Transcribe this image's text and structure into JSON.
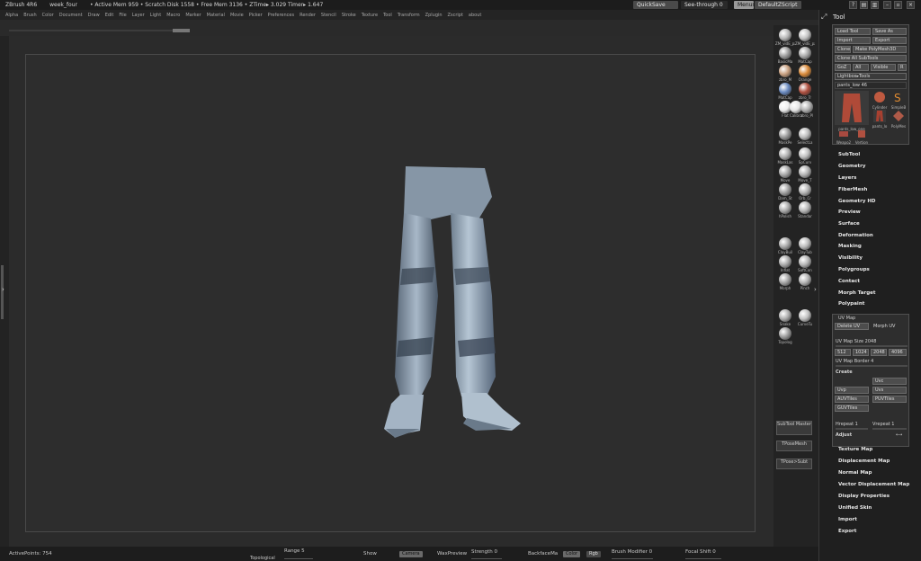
{
  "titlebar": {
    "app": "ZBrush 4R6",
    "doc": "week_four",
    "mem": "• Active Mem 959 • Scratch Disk 1558 • Free Mem 3136 • ZTime▸ 3.029 Timer▸ 1.647",
    "quicksave": "QuickSave",
    "seethrough": "See-through 0",
    "menus": "Menus",
    "script": "DefaultZScript"
  },
  "menubar": [
    "Alpha",
    "Brush",
    "Color",
    "Document",
    "Draw",
    "Edit",
    "File",
    "Layer",
    "Light",
    "Macro",
    "Marker",
    "Material",
    "Movie",
    "Picker",
    "Preferences",
    "Render",
    "Stencil",
    "Stroke",
    "Texture",
    "Tool",
    "Transform",
    "Zplugin",
    "Zscript",
    "about"
  ],
  "shelf": {
    "brushes": [
      {
        "label": "ZM_vidE_palt",
        "color": "#b8b8b8"
      },
      {
        "label": "ZM_vidE_palt",
        "color": "#c4c4c4"
      },
      {
        "label": "BasicMa",
        "color": "#9c9c9c"
      },
      {
        "label": "MatCap",
        "color": "#a9a9a9"
      },
      {
        "label": "zbro_M",
        "color": "#c8a080"
      },
      {
        "label": "Orange",
        "color": "#d98a3a"
      },
      {
        "label": "MatCap",
        "color": "#6a8ac0"
      },
      {
        "label": "zbro_Tr",
        "color": "#b05040"
      },
      {
        "label": "Flat",
        "color": "#eeeeee"
      },
      {
        "label": "Calibra",
        "color": "#e6e6e6"
      },
      {
        "label": "zbro_Pl",
        "color": "#b0b0b0"
      },
      {
        "label": "MaskPe",
        "color": "#9a9a9a"
      },
      {
        "label": "SelectLa",
        "color": "#bdbdbd"
      },
      {
        "label": "MaskLas",
        "color": "#b0b0b0"
      },
      {
        "label": "SpCurv",
        "color": "#c0c0c0"
      },
      {
        "label": "Move",
        "color": "#a6a6a6"
      },
      {
        "label": "Move_T",
        "color": "#b2b2b2"
      },
      {
        "label": "Dam_St",
        "color": "#a0a0a0"
      },
      {
        "label": "Orb_Cr",
        "color": "#b4b4b4"
      },
      {
        "label": "hPolish",
        "color": "#aaaaaa"
      },
      {
        "label": "Standar",
        "color": "#b8b8b8"
      },
      {
        "label": "ClayBuil",
        "color": "#a8a8a8"
      },
      {
        "label": "ClayTub",
        "color": "#bcbcbc"
      },
      {
        "label": "Inflat",
        "color": "#aaaaaa"
      },
      {
        "label": "SoftCon",
        "color": "#b6b6b6"
      },
      {
        "label": "Morph",
        "color": "#a4a4a4"
      },
      {
        "label": "Pinch",
        "color": "#b4b4b4"
      },
      {
        "label": "Snake",
        "color": "#aeaeae"
      },
      {
        "label": "CurveTu",
        "color": "#c2c2c2"
      },
      {
        "label": "Topolog",
        "color": "#9e9e9e"
      }
    ],
    "buttons": [
      "SubTool Master",
      "TPoseMesh",
      "TPose>Subt"
    ]
  },
  "tool": {
    "title": "Tool",
    "buttons": [
      {
        "label": "Load Tool"
      },
      {
        "label": "Save As"
      },
      {
        "label": "Import"
      },
      {
        "label": "Export"
      },
      {
        "label": "Clone"
      },
      {
        "label": "Make PolyMesh3D"
      },
      {
        "label": "Clone All SubTools"
      },
      {
        "label": "GoZ"
      },
      {
        "label": "All"
      },
      {
        "label": "Visible"
      },
      {
        "label": "R"
      },
      {
        "label": "Lightbox▸Tools"
      }
    ],
    "current_tool": "pants_low 46",
    "thumbs": [
      {
        "label": "pants_low_one",
        "color": "#b04a38"
      },
      {
        "label": "Cylinder",
        "color": "#c05a40"
      },
      {
        "label": "SimpleB",
        "color": "#e08a30"
      },
      {
        "label": "pants_lo",
        "color": "#a84030"
      },
      {
        "label": "PolyMes",
        "color": "#b05a48"
      },
      {
        "label": "Weapo2",
        "color": "#a84a40"
      },
      {
        "label": "Vertion",
        "color": "#b05040"
      }
    ],
    "sections_top": [
      "SubTool",
      "Geometry",
      "Layers",
      "FiberMesh",
      "Geometry HD",
      "Preview",
      "Surface",
      "Deformation",
      "Masking",
      "Visibility",
      "Polygroups",
      "Contact",
      "Morph Target",
      "Polypaint"
    ],
    "uv": {
      "header": "UV Map",
      "delete_uv": "Delete UV",
      "morph_uv": "Morph UV",
      "uv_map_size": "UV Map Size 2048",
      "sizes": [
        "512",
        "1024",
        "2048",
        "4096"
      ],
      "uv_map_border": "UV Map Border 4",
      "create": "Create",
      "uv_buttons": [
        "Uvc",
        "Uvp",
        "Uvs",
        "AUVTiles",
        "PUVTiles",
        "GUVTiles"
      ],
      "hrepeat": "Hrepeat 1",
      "vrepeat": "Vrepeat 1",
      "adjust": "Adjust"
    },
    "sections_bottom": [
      "Texture Map",
      "Displacement Map",
      "Normal Map",
      "Vector Displacement Map",
      "Display Properties",
      "Unified Skin",
      "Import",
      "Export"
    ]
  },
  "status": {
    "activepoints": "ActivePoints: 754",
    "range": "Range 5",
    "topological": "Topological",
    "show": "Show",
    "camera": "Camera",
    "waxpreview": "WaxPreview",
    "strength": "Strength 0",
    "backfacemask": "BackfaceMa",
    "color": "Color",
    "rgb": "Rgb",
    "brush_modifier": "Brush Modifier 0",
    "focal_shift": "Focal Shift 0"
  }
}
